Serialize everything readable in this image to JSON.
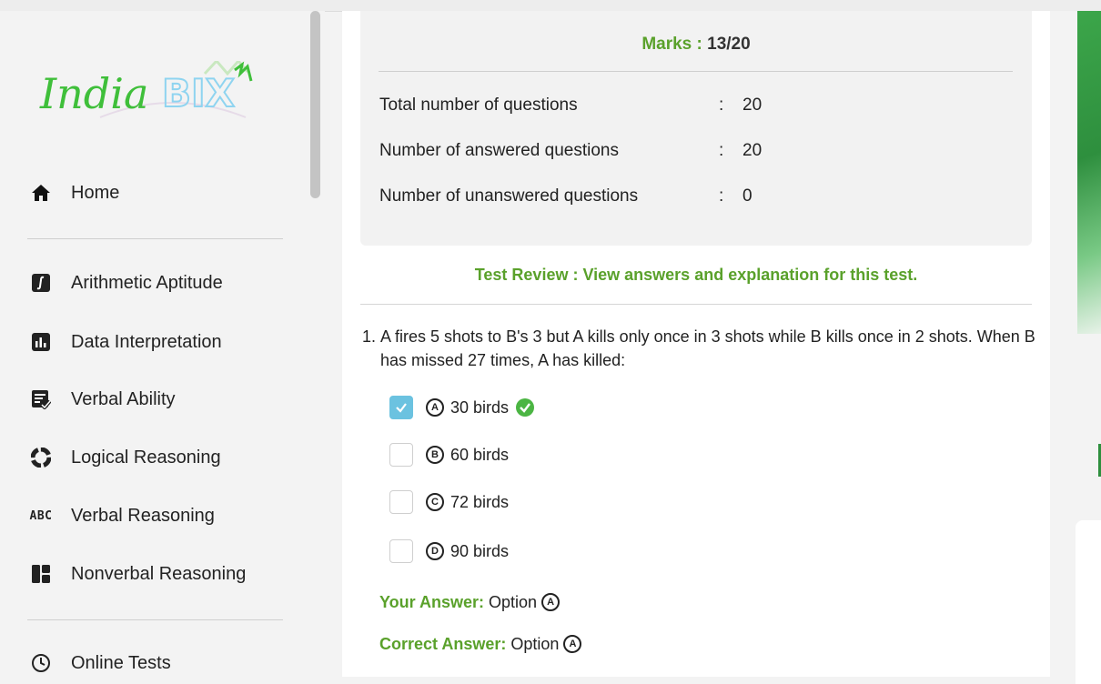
{
  "sidebar": {
    "logo_text": "IndiaBIX",
    "items": [
      {
        "label": "Home",
        "icon": "home-icon"
      },
      {
        "label": "Arithmetic Aptitude",
        "icon": "integral-icon"
      },
      {
        "label": "Data Interpretation",
        "icon": "bar-chart-icon"
      },
      {
        "label": "Verbal Ability",
        "icon": "document-check-icon"
      },
      {
        "label": "Logical Reasoning",
        "icon": "puzzle-icon"
      },
      {
        "label": "Verbal Reasoning",
        "icon": "abc-icon"
      },
      {
        "label": "Nonverbal Reasoning",
        "icon": "layout-icon"
      },
      {
        "label": "Online Tests",
        "icon": "clock-icon"
      }
    ],
    "abc_glyph": "ABC"
  },
  "summary": {
    "marks_label": "Marks :",
    "marks_value": "13/20",
    "rows": [
      {
        "label": "Total number of questions",
        "colon": ":",
        "value": "20"
      },
      {
        "label": "Number of answered questions",
        "colon": ":",
        "value": "20"
      },
      {
        "label": "Number of unanswered questions",
        "colon": ":",
        "value": "0"
      }
    ]
  },
  "review": {
    "text": "Test Review : View answers and explanation for this test."
  },
  "question": {
    "number": "1.",
    "text": "A fires 5 shots to B's 3 but A kills only once in 3 shots while B kills once in 2 shots. When B has missed 27 times, A has killed:",
    "options": [
      {
        "letter": "A",
        "text": "30 birds",
        "checked": true,
        "correct": true
      },
      {
        "letter": "B",
        "text": "60 birds",
        "checked": false,
        "correct": false
      },
      {
        "letter": "C",
        "text": "72 birds",
        "checked": false,
        "correct": false
      },
      {
        "letter": "D",
        "text": "90 birds",
        "checked": false,
        "correct": false
      }
    ],
    "your_answer_label": "Your Answer:",
    "your_answer_value": "Option",
    "your_answer_letter": "A",
    "correct_answer_label": "Correct Answer:",
    "correct_answer_value": "Option",
    "correct_answer_letter": "A"
  },
  "colors": {
    "accent_green": "#5aa12b",
    "checkbox_blue": "#6bc2e0",
    "correct_green": "#4bb543"
  }
}
